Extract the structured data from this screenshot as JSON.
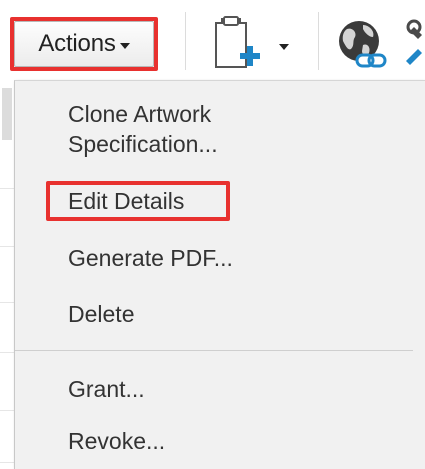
{
  "toolbar": {
    "actions_label": "Actions",
    "icons": [
      "new-document-icon",
      "web-link-icon",
      "partial-icon"
    ],
    "highlight_color": "#e8312f"
  },
  "menu": {
    "items": [
      {
        "line1": "Clone Artwork",
        "line2": "Specification..."
      },
      {
        "label": "Edit Details",
        "highlighted": true
      },
      {
        "label": "Generate PDF..."
      },
      {
        "label": "Delete"
      },
      {
        "label": "Grant..."
      },
      {
        "label": "Revoke..."
      }
    ]
  }
}
